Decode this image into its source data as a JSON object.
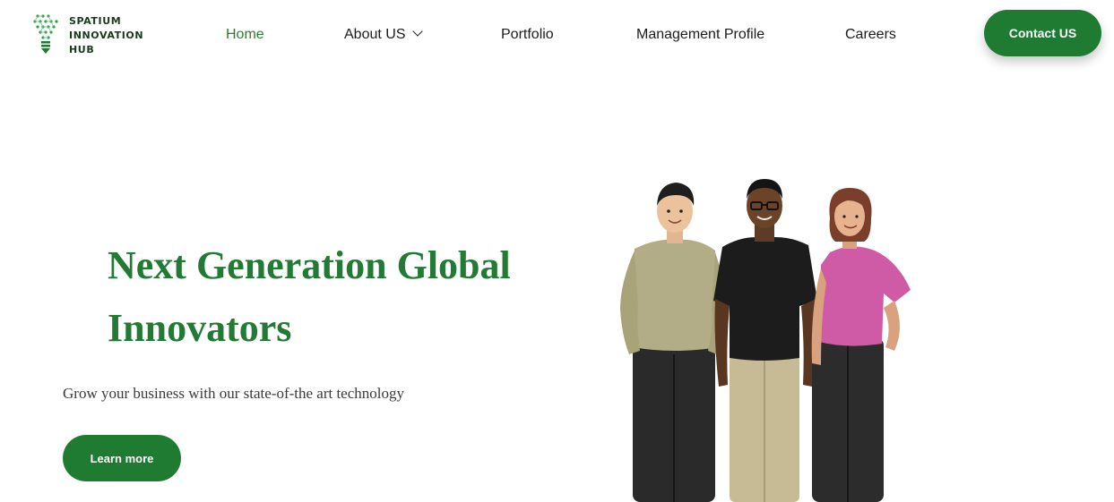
{
  "brand": {
    "line1": "SPATIUM",
    "line2": "INNOVATION",
    "line3": "HUB",
    "accent_color": "#1f7a32"
  },
  "nav": {
    "home": "Home",
    "about": "About US",
    "portfolio": "Portfolio",
    "management": "Management Profile",
    "careers": "Careers",
    "active": "Home"
  },
  "header": {
    "contact_label": "Contact US"
  },
  "hero": {
    "title": "Next Generation Global Innovators",
    "subtitle": "Grow your business with our state-of-the art technology",
    "cta_label": "Learn more",
    "illustration": "three-people-3d-illustration"
  }
}
